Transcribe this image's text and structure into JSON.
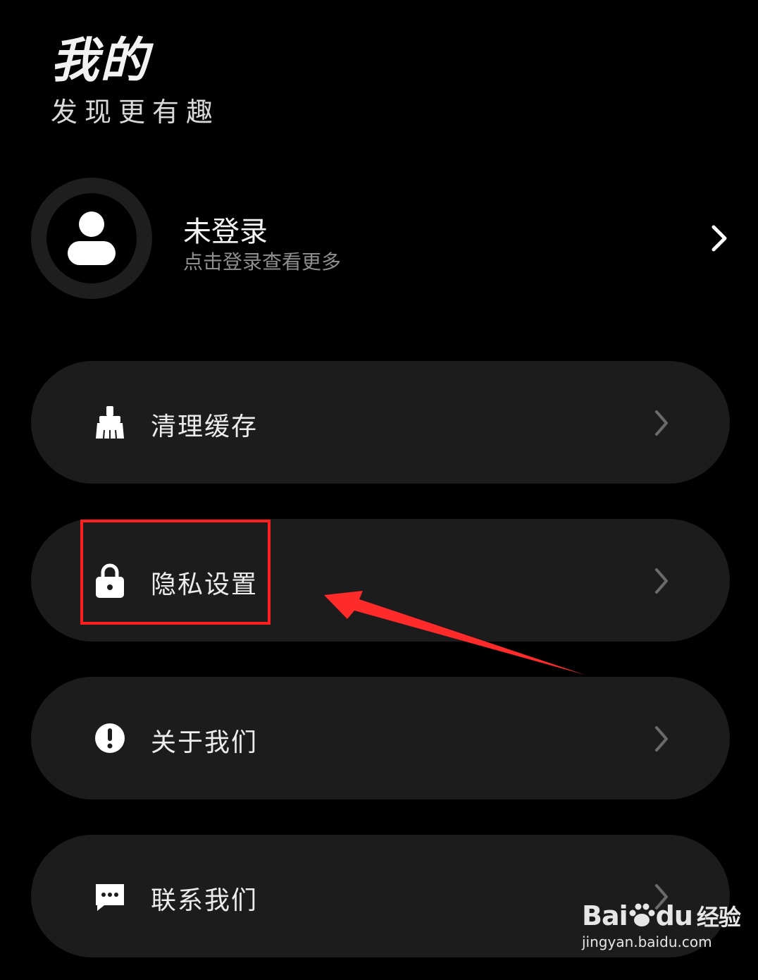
{
  "header": {
    "title": "我的",
    "subtitle": "发现更有趣"
  },
  "profile": {
    "name": "未登录",
    "hint": "点击登录查看更多"
  },
  "menu": {
    "items": [
      {
        "label": "清理缓存",
        "icon": "broom-icon"
      },
      {
        "label": "隐私设置",
        "icon": "lock-icon"
      },
      {
        "label": "关于我们",
        "icon": "exclamation-icon"
      },
      {
        "label": "联系我们",
        "icon": "chat-icon"
      }
    ]
  },
  "annotation": {
    "highlight_color": "#ff1f1f",
    "highlight_target": "隐私设置"
  },
  "watermark": {
    "brand_latin": "Bai",
    "brand_latin2": "du",
    "brand_cn": "经验",
    "url": "jingyan.baidu.com"
  }
}
